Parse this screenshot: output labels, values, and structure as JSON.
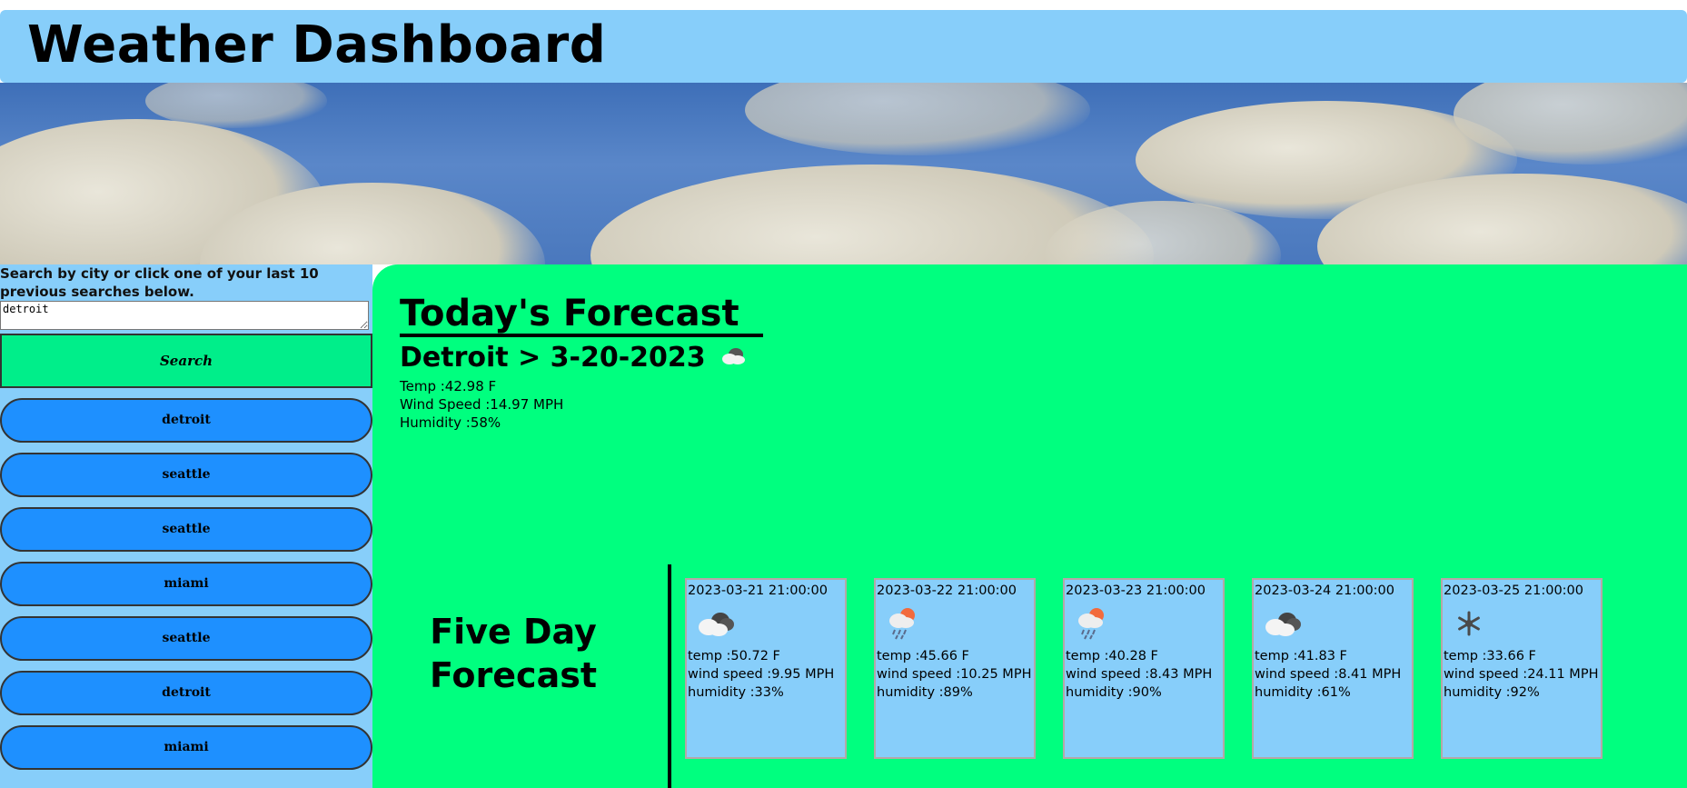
{
  "header": {
    "title": "Weather Dashboard"
  },
  "sidebar": {
    "prompt": "Search by city or click one of your last 10 previous searches below.",
    "search_value": "detroit",
    "search_label": "Search",
    "history": [
      "detroit",
      "seattle",
      "seattle",
      "miami",
      "seattle",
      "detroit",
      "miami"
    ]
  },
  "today": {
    "heading": "Today's Forecast",
    "city_date": "Detroit > 3-20-2023",
    "icon": "cloud-icon",
    "temp": "Temp :42.98 F",
    "wind": "Wind Speed :14.97 MPH",
    "humidity": "Humidity :58%"
  },
  "five_day": {
    "heading": "Five Day Forecast",
    "days": [
      {
        "date": "2023-03-21 21:00:00",
        "icon": "overcast-cloud-icon",
        "temp": "temp :50.72 F",
        "wind": "wind speed :9.95 MPH",
        "humidity": "humidity :33%"
      },
      {
        "date": "2023-03-22 21:00:00",
        "icon": "rain-sun-icon",
        "temp": "temp :45.66 F",
        "wind": "wind speed :10.25 MPH",
        "humidity": "humidity :89%"
      },
      {
        "date": "2023-03-23 21:00:00",
        "icon": "rain-sun-icon",
        "temp": "temp :40.28 F",
        "wind": "wind speed :8.43 MPH",
        "humidity": "humidity :90%"
      },
      {
        "date": "2023-03-24 21:00:00",
        "icon": "overcast-cloud-icon",
        "temp": "temp :41.83 F",
        "wind": "wind speed :8.41 MPH",
        "humidity": "humidity :61%"
      },
      {
        "date": "2023-03-25 21:00:00",
        "icon": "snowflake-icon",
        "temp": "temp :33.66 F",
        "wind": "wind speed :24.11 MPH",
        "humidity": "humidity :92%"
      }
    ]
  },
  "colors": {
    "header_bg": "#87cefa",
    "main_bg": "#00ff7f",
    "history_btn": "#1e90ff",
    "search_btn": "#00ee8a"
  }
}
